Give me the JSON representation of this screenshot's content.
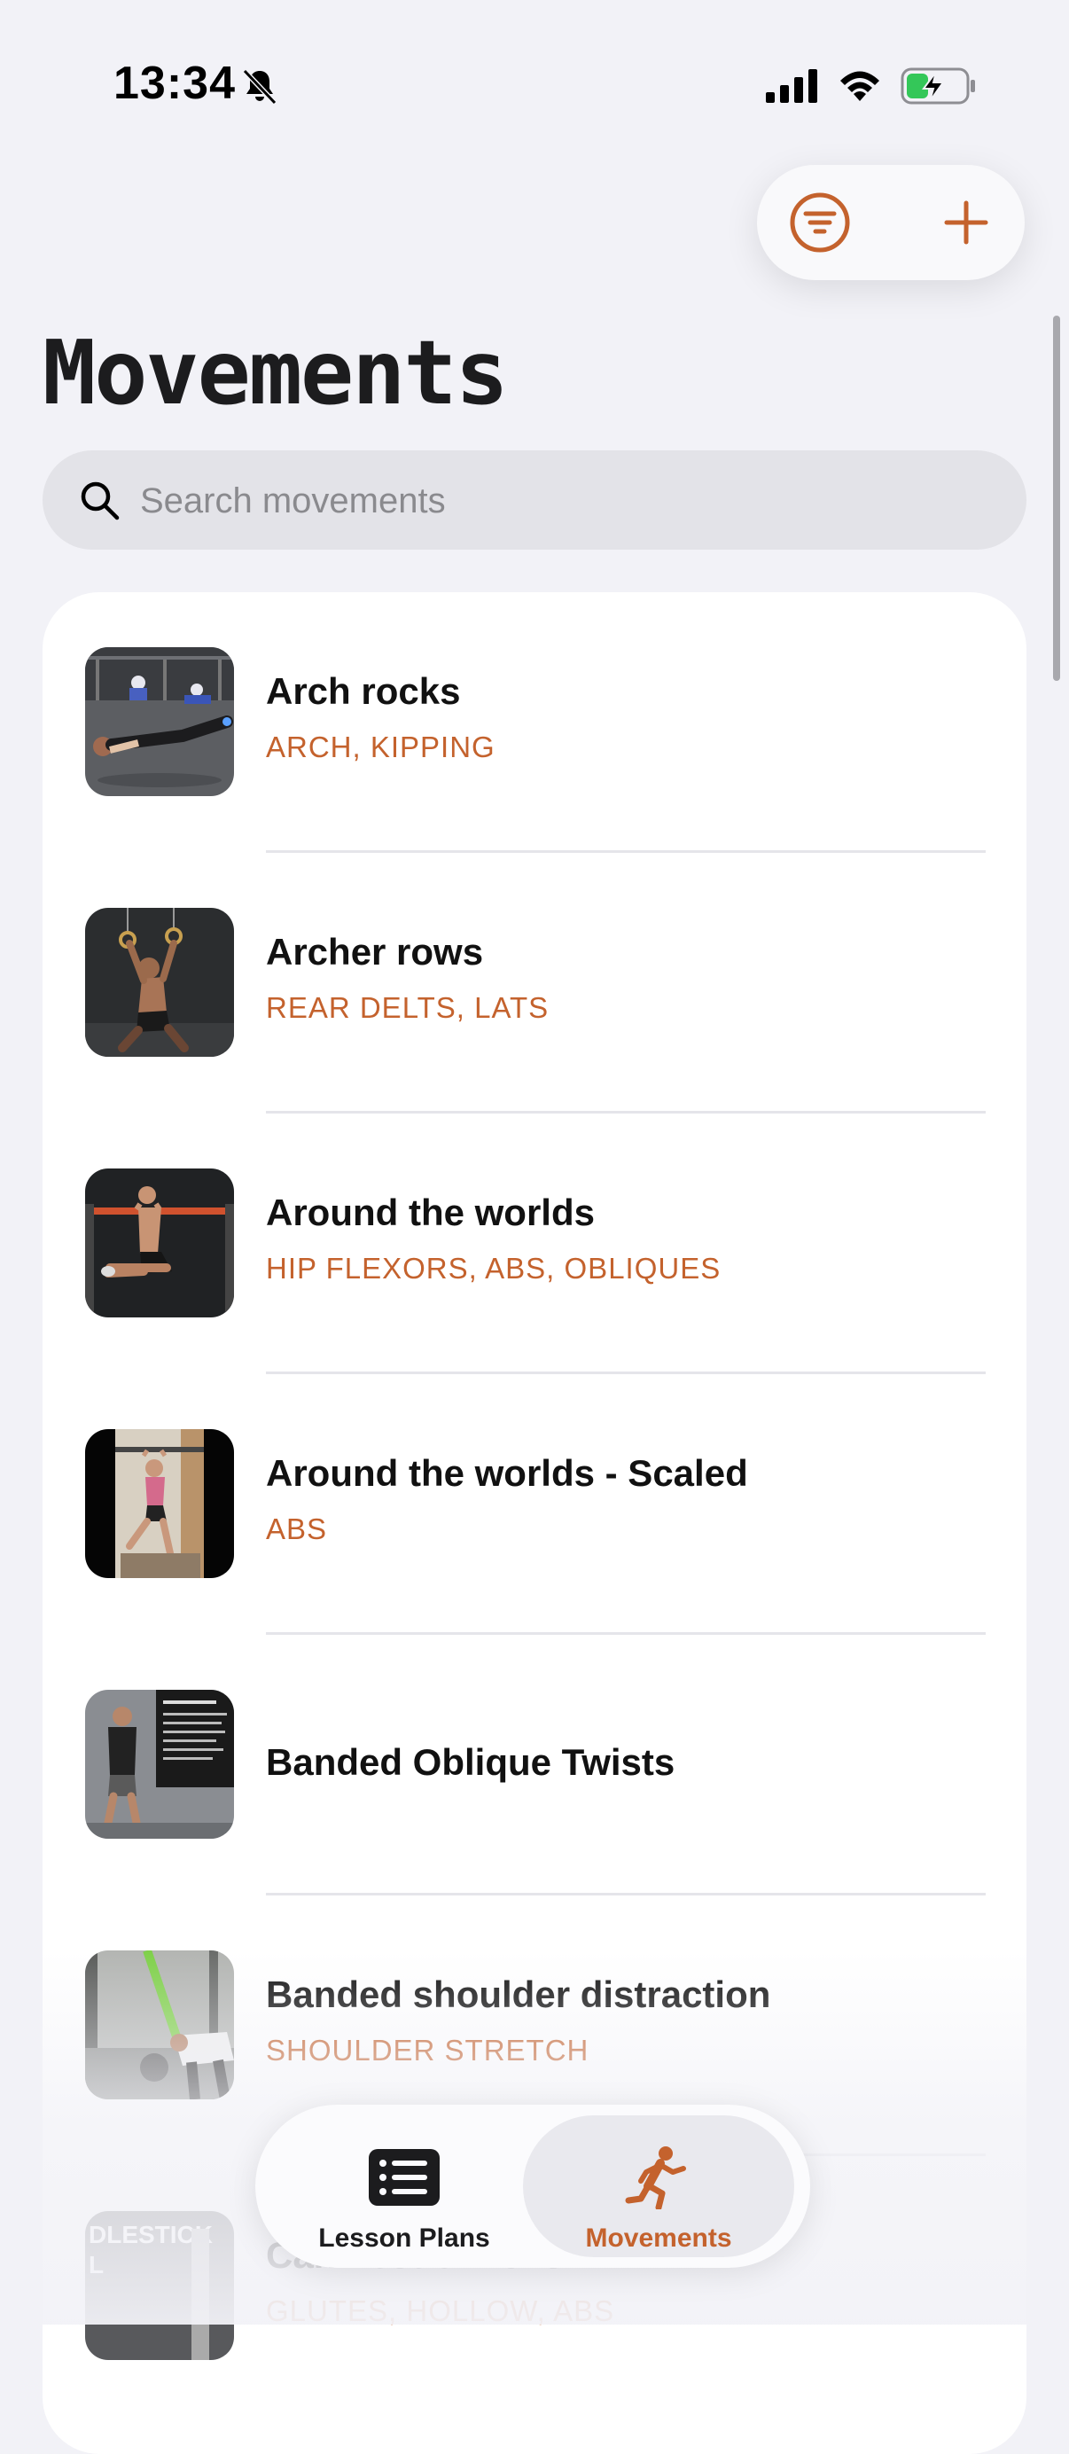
{
  "status_bar": {
    "time": "13:34"
  },
  "colors": {
    "accent": "#c4622d",
    "background": "#f2f2f7",
    "card": "#ffffff"
  },
  "toolbar": {
    "filter_icon": "filter-icon",
    "add_icon": "plus-icon"
  },
  "page": {
    "title": "Movements"
  },
  "search": {
    "placeholder": "Search movements",
    "value": ""
  },
  "movements": [
    {
      "name": "Arch rocks",
      "tags": "ARCH, KIPPING"
    },
    {
      "name": "Archer rows",
      "tags": "REAR DELTS, LATS"
    },
    {
      "name": "Around the worlds",
      "tags": "HIP FLEXORS, ABS, OBLIQUES"
    },
    {
      "name": "Around the worlds - Scaled",
      "tags": "ABS"
    },
    {
      "name": "Banded Oblique Twists",
      "tags": ""
    },
    {
      "name": "Banded shoulder distraction",
      "tags": "SHOULDER STRETCH"
    },
    {
      "name": "Candlestick rolls",
      "tags": "GLUTES, HOLLOW, ABS",
      "thumb_text": "DLESTICK\nL"
    }
  ],
  "tab_bar": {
    "tabs": [
      {
        "label": "Lesson Plans",
        "icon": "list-icon",
        "selected": false
      },
      {
        "label": "Movements",
        "icon": "running-figure-icon",
        "selected": true
      }
    ]
  }
}
